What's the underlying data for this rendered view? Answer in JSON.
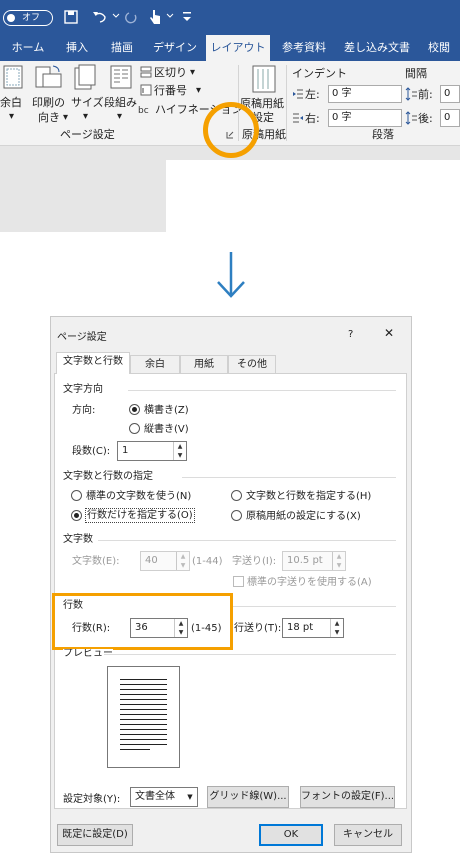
{
  "ribbon": {
    "qat_toggle": "オフ",
    "tabs": [
      "ホーム",
      "挿入",
      "描画",
      "デザイン",
      "レイアウト",
      "参考資料",
      "差し込み文書",
      "校閲"
    ],
    "active_tab": "レイアウト",
    "page_setup": {
      "margins": "余白",
      "orientation_1": "印刷の",
      "orientation_2": "向き",
      "size": "サイズ",
      "columns": "段組み",
      "breaks": "区切り",
      "line_numbers": "行番号",
      "hyphenation": "ハイフネーション",
      "group_label": "ページ設定"
    },
    "genko": {
      "button_1": "原稿用紙",
      "button_2": "設定",
      "group_label": "原稿用紙"
    },
    "paragraph": {
      "indent": "インデント",
      "spacing": "間隔",
      "left_label": "左:",
      "left_value": "0 字",
      "right_label": "右:",
      "right_value": "0 字",
      "before_label": "前:",
      "before_value": "0",
      "after_label": "後:",
      "after_value": "0",
      "group_label": "段落"
    }
  },
  "dialog": {
    "title": "ページ設定",
    "help": "?",
    "close": "✕",
    "tabs": [
      "文字数と行数",
      "余白",
      "用紙",
      "その他"
    ],
    "direction": {
      "heading": "文字方向",
      "label": "方向:",
      "horizontal": "横書き(Z)",
      "vertical": "縦書き(V)",
      "columns_label": "段数(C):",
      "columns_value": "1"
    },
    "grid": {
      "heading": "文字数と行数の指定",
      "opt_standard": "標準の文字数を使う(N)",
      "opt_chars_lines": "文字数と行数を指定する(H)",
      "opt_lines_only": "行数だけを指定する(O)",
      "opt_genko": "原稿用紙の設定にする(X)"
    },
    "chars": {
      "heading": "文字数",
      "count_label": "文字数(E):",
      "count_value": "40",
      "count_range": "(1-44)",
      "pitch_label": "字送り(I):",
      "pitch_value": "10.5 pt",
      "standard_pitch": "標準の字送りを使用する(A)"
    },
    "lines": {
      "heading": "行数",
      "count_label": "行数(R):",
      "count_value": "36",
      "count_range": "(1-45)",
      "pitch_label": "行送り(T):",
      "pitch_value": "18 pt"
    },
    "preview_label": "プレビュー",
    "apply_label": "設定対象(Y):",
    "apply_value": "文書全体",
    "grid_button": "グリッド線(W)...",
    "font_button": "フォントの設定(F)...",
    "default_button": "既定に設定(D)",
    "ok": "OK",
    "cancel": "キャンセル"
  }
}
